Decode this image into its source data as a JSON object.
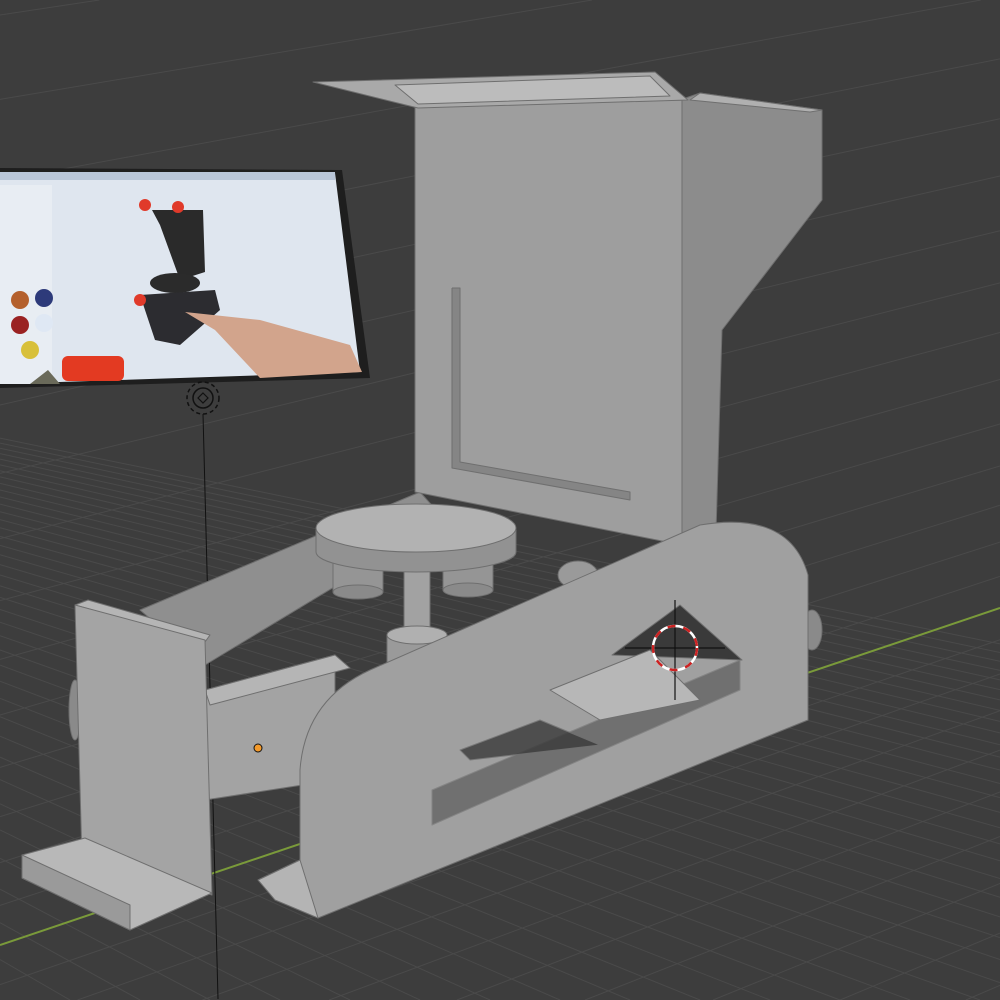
{
  "viewport": {
    "background_color": "#3d3d3d",
    "grid_color": "#4a4a4a",
    "x_axis_color": "#7a9a3a"
  },
  "scene": {
    "model_color": "#9d9d9d",
    "reference_image_icon": "image-plane",
    "empty_icon": "empty-object-icon",
    "cursor_icon": "3d-cursor-icon",
    "origin_icon": "origin-dot-icon",
    "origin_color": "#f39a2b",
    "cursor_colors": [
      "#cc2222",
      "#ffffff"
    ]
  }
}
